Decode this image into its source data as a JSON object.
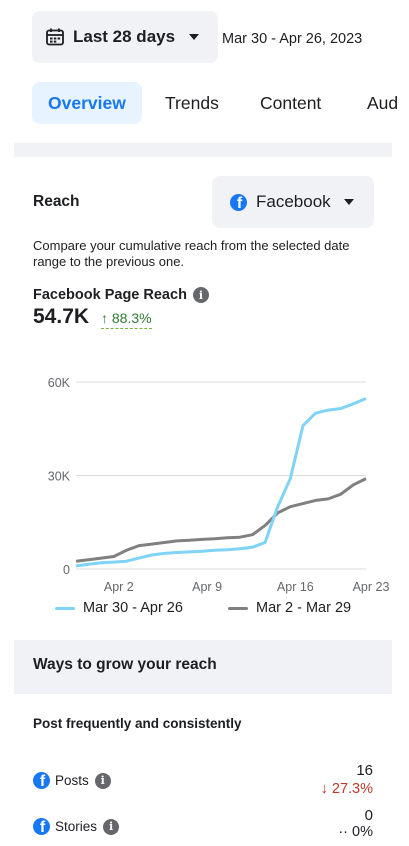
{
  "date_picker": {
    "label": "Last 28 days",
    "range": "Mar 30 - Apr 26, 2023"
  },
  "tabs": [
    {
      "label": "Overview",
      "active": true
    },
    {
      "label": "Trends",
      "active": false
    },
    {
      "label": "Content",
      "active": false
    },
    {
      "label": "Aud",
      "active": false
    }
  ],
  "reach": {
    "title": "Reach",
    "platform": "Facebook",
    "description": "Compare your cumulative reach from the selected date range to the previous one.",
    "metric_label": "Facebook Page Reach",
    "metric_value": "54.7K",
    "metric_change": "88.3%"
  },
  "chart_data": {
    "type": "line",
    "y_ticks": [
      "60K",
      "30K",
      "0"
    ],
    "x_ticks": [
      "Apr 2",
      "Apr 9",
      "Apr 16",
      "Apr 23"
    ],
    "ylim": [
      0,
      60000
    ],
    "grid": true,
    "legend_placement": "bottom",
    "series": [
      {
        "name": "Mar 30 - Apr 26",
        "color": "#7fd3f7",
        "values": [
          1000,
          1500,
          2000,
          2200,
          2500,
          3500,
          4500,
          5000,
          5300,
          5500,
          5700,
          6000,
          6200,
          6500,
          7000,
          8500,
          20000,
          29000,
          46000,
          50000,
          51000,
          51500,
          53000,
          54700
        ]
      },
      {
        "name": "Mar 2 - Mar 29",
        "color": "#808080",
        "values": [
          2500,
          3000,
          3500,
          4000,
          6000,
          7500,
          8000,
          8500,
          9000,
          9200,
          9500,
          9700,
          10000,
          10200,
          11000,
          14000,
          18000,
          20000,
          21000,
          22000,
          22500,
          24000,
          27000,
          29000
        ]
      }
    ]
  },
  "ways": {
    "title": "Ways to grow your reach",
    "subtitle": "Post frequently and consistently",
    "items": [
      {
        "label": "Posts",
        "value": "16",
        "change": "27.3%",
        "direction": "down",
        "color": "#c0392b"
      },
      {
        "label": "Stories",
        "value": "0",
        "change": "0%",
        "direction": "flat",
        "color": "#1c1e21"
      }
    ]
  },
  "colors": {
    "accent": "#1877f2",
    "positive": "#2e7d32",
    "negative": "#c0392b",
    "panel": "#f0f2f5"
  }
}
